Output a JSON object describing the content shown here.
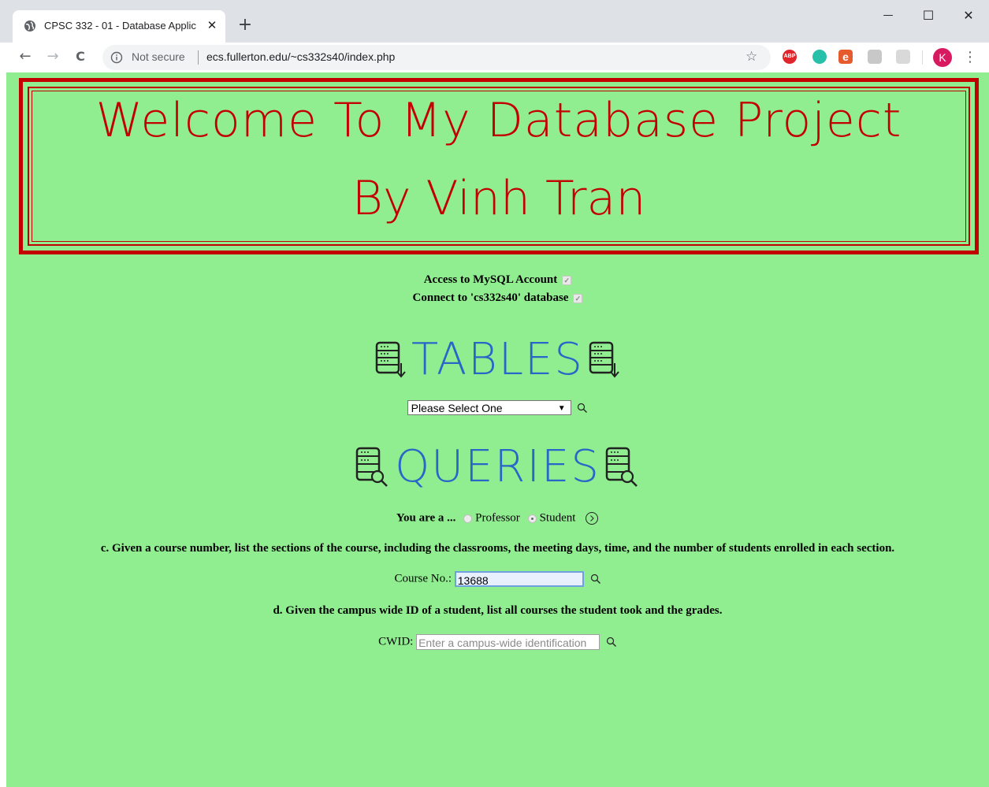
{
  "browser": {
    "tab_title": "CPSC 332 - 01 - Database Applic",
    "tab_close": "✕",
    "new_tab": "+",
    "security_label": "Not secure",
    "url": "ecs.fullerton.edu/~cs332s40/index.php",
    "profile_initial": "K",
    "window_min": "—",
    "window_max": "☐",
    "window_close": "✕",
    "nav_back": "←",
    "nav_forward": "→",
    "nav_reload": "C",
    "bookmark_star": "☆",
    "menu": "⋮",
    "extensions": [
      {
        "name": "abp-extension-icon",
        "label": "ABP",
        "color": "#e0262b"
      },
      {
        "name": "circle-extension-icon",
        "label": "",
        "color": "#27c0a8"
      },
      {
        "name": "e-extension-icon",
        "label": "e",
        "color": "#e55b2d"
      },
      {
        "name": "translate-extension-icon",
        "label": "",
        "color": "#b9b9b9"
      },
      {
        "name": "pdf-extension-icon",
        "label": "",
        "color": "#d9d9d9"
      }
    ],
    "colors": {
      "tabstrip": "#dee1e6",
      "omnibox": "#f1f3f4",
      "profile": "#d81b60"
    }
  },
  "banner": {
    "line1": "Welcome To My Database Project",
    "line2": "By Vinh Tran",
    "color": "#c30000"
  },
  "status": {
    "mysql": "Access to MySQL Account",
    "database": "Connect to 'cs332s40' database"
  },
  "tables": {
    "heading": "TABLES",
    "select_value": "Please Select One",
    "select_arrow": "▼"
  },
  "queries": {
    "heading": "QUERIES",
    "role_label": "You are a ...",
    "role_options": [
      "Professor",
      "Student"
    ],
    "selected_role": "Student",
    "go_icon": "⦿"
  },
  "query_c": {
    "text": "c. Given a course number, list the sections of the course, including the classrooms, the meeting days, time, and the number of students enrolled in each section.",
    "label": "Course No.:",
    "value": "13688"
  },
  "query_d": {
    "text": "d. Given the campus wide ID of a student, list all courses the student took and the grades.",
    "label": "CWID:",
    "placeholder": "Enter a campus-wide identification"
  },
  "page_colors": {
    "background": "#90ee90",
    "heading": "#2a65c8"
  }
}
